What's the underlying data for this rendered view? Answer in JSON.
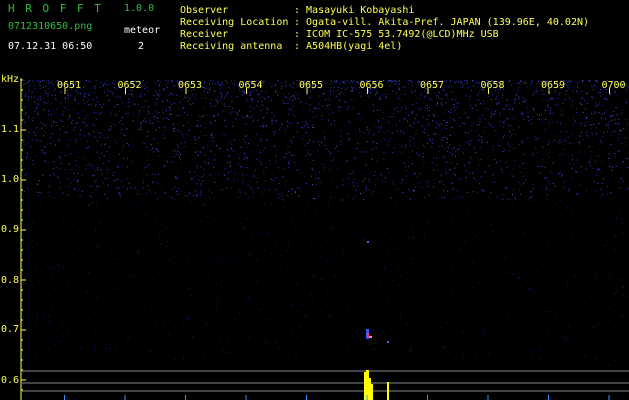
{
  "app": {
    "title": "H R O F F T",
    "version": "1.0.0",
    "filename": "0712310650.png",
    "datetime": "07.12.31 06:50",
    "meteor_label": "meteor",
    "meteor_count": "2"
  },
  "info": {
    "observer_label": "Observer",
    "observer_value": ": Masayuki Kobayashi",
    "location_label": "Receiving Location",
    "location_value": ": Ogata-vill. Akita-Pref. JAPAN (139.96E, 40.02N)",
    "receiver_label": "Receiver",
    "receiver_value": ": ICOM IC-575 53.7492(@LCD)MHz USB",
    "antenna_label": "Receiving antenna",
    "antenna_value": ": A504HB(yagi 4el)"
  },
  "axis": {
    "unit": "kHz",
    "y_ticks": [
      "1.1",
      "1.0",
      "0.9",
      "0.8",
      "0.7",
      "0.6"
    ],
    "x_ticks": [
      "0651",
      "0652",
      "0653",
      "0654",
      "0655",
      "0656",
      "0657",
      "0658",
      "0659",
      "0700"
    ]
  },
  "colors": {
    "header_green": "#2fbf3f",
    "label_yellow": "#ffff55",
    "noise_blue": "#2a2aa0",
    "echo_color": "#ff3366",
    "meter_color": "#ffff00"
  }
}
